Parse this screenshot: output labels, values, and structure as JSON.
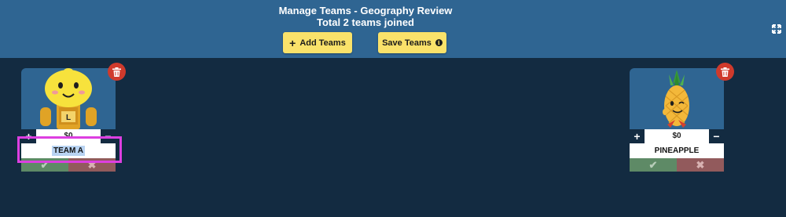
{
  "header": {
    "title": "Manage Teams - Geography Review",
    "subtitle": "Total 2 teams joined",
    "add_label": "Add Teams",
    "save_label": "Save Teams"
  },
  "icons": {
    "add": "plus-icon",
    "save_info": "info-icon",
    "expand": "expand-icon",
    "delete": "trash-icon",
    "confirm": "check-icon",
    "cancel": "x-icon"
  },
  "teams": [
    {
      "name": "TEAM A",
      "score": "$0",
      "avatar": "lemon-character",
      "avatar_letter": "L",
      "plus": "+",
      "minus": "−",
      "check": "✔",
      "x": "✖"
    },
    {
      "name": "PINEAPPLE",
      "score": "$0",
      "avatar": "pineapple-character",
      "plus": "+",
      "minus": "−",
      "check": "✔",
      "x": "✖"
    }
  ],
  "colors": {
    "header_bg": "#2f6592",
    "page_bg": "#132b41",
    "button_yellow": "#fae26a",
    "delete_red": "#cf3a2c",
    "confirm_green": "#5e8a66",
    "cancel_red": "#925a5c",
    "focus_magenta": "#dd3fe1"
  }
}
